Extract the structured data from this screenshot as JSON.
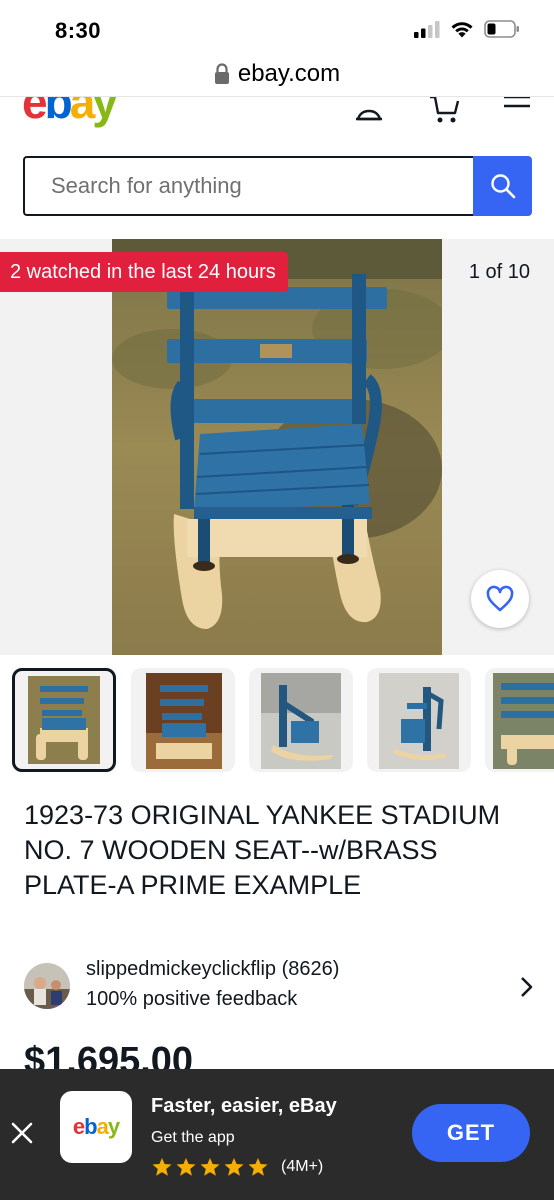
{
  "status_bar": {
    "time": "8:30",
    "icons": [
      "signal-icon",
      "wifi-icon",
      "battery-icon"
    ]
  },
  "browser": {
    "url": "ebay.com",
    "icon": "lock-icon"
  },
  "header": {
    "logo_letters": [
      "e",
      "b",
      "a",
      "y"
    ],
    "logo_colors": [
      "#e53238",
      "#0064d2",
      "#f5af02",
      "#86b817"
    ],
    "icons": [
      "account-icon",
      "cart-icon",
      "menu-icon"
    ]
  },
  "search": {
    "placeholder": "Search for anything",
    "value": "",
    "button_color": "#3665f3"
  },
  "gallery": {
    "watch_badge": "2 watched in the last 24 hours",
    "watch_badge_color": "#e0203d",
    "counter": "1 of 10",
    "selected_index": 0,
    "thumbnail_count": 5
  },
  "listing": {
    "title": "1923-73 ORIGINAL YANKEE STADIUM NO. 7 WOODEN SEAT--w/BRASS PLATE-A PRIME EXAMPLE",
    "price": "$1,695.00"
  },
  "seller": {
    "name": "slippedmickeyclickflip (8626)",
    "feedback": "100% positive feedback"
  },
  "app_banner": {
    "icon_letters": [
      "e",
      "b",
      "a",
      "y"
    ],
    "title": "Faster, easier, eBay",
    "subtitle": "Get the app",
    "rating_stars": 5,
    "rating_count": "(4M+)",
    "cta": "GET",
    "cta_color": "#3665f3",
    "star_color": "#f5af02"
  }
}
